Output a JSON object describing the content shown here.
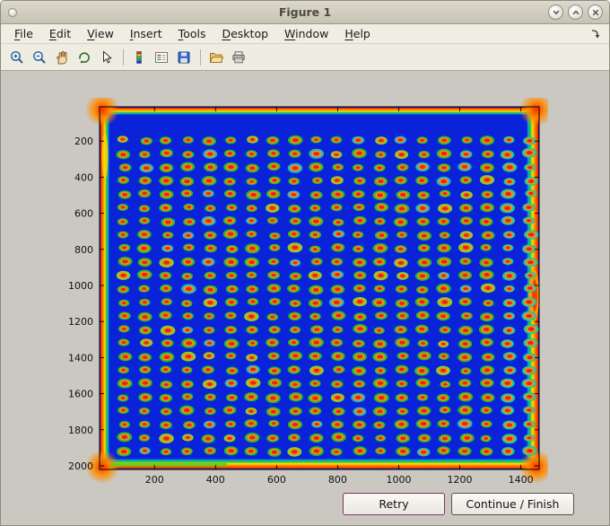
{
  "window": {
    "title": "Figure 1",
    "controls": {
      "shade": "shade",
      "maximize": "maximize",
      "close": "close"
    }
  },
  "menu": {
    "items": [
      {
        "label": "File",
        "underline": 0
      },
      {
        "label": "Edit",
        "underline": 0
      },
      {
        "label": "View",
        "underline": 0
      },
      {
        "label": "Insert",
        "underline": 0
      },
      {
        "label": "Tools",
        "underline": 0
      },
      {
        "label": "Desktop",
        "underline": 0
      },
      {
        "label": "Window",
        "underline": 0
      },
      {
        "label": "Help",
        "underline": 0
      }
    ]
  },
  "toolbar": {
    "groups": [
      [
        "zoom-in",
        "zoom-out",
        "pan",
        "rotate-3d",
        "data-cursor"
      ],
      [
        "colorbar",
        "insert-legend",
        "save"
      ],
      [
        "open-folder",
        "print"
      ]
    ]
  },
  "chart_data": {
    "type": "heatmap",
    "title": "",
    "xlabel": "",
    "ylabel": "",
    "description": "Pseudocolor (jet colormap) image of a dot-blot / microarray scan: deep blue background, 20x24 grid of spots with red cores, orange rings and green rims; hot red/orange borders around all image edges with green transition stripes.",
    "x_ticks": [
      200,
      400,
      600,
      800,
      1000,
      1200,
      1400
    ],
    "y_ticks": [
      200,
      400,
      600,
      800,
      1000,
      1200,
      1400,
      1600,
      1800,
      2000
    ],
    "x_range": [
      20,
      1460
    ],
    "y_range": [
      10,
      2020
    ],
    "grid": {
      "cols": 20,
      "rows": 24,
      "x_start": 100,
      "x_step": 70,
      "y_start": 195,
      "y_step": 75
    },
    "colors": {
      "background": "#0a22d8",
      "spot_core": "#dd2b10",
      "spot_mid": "#ff8c12",
      "spot_rim": "#22bb33",
      "spot_rim_right": "#19c9a0",
      "edge_hot": "#e62200",
      "edge_warm": "#ff8800",
      "edge_yellow": "#ffe000",
      "edge_green": "#28c832",
      "edge_cyan": "#00a8e0"
    }
  },
  "buttons": {
    "retry": "Retry",
    "continue_finish": "Continue / Finish"
  }
}
